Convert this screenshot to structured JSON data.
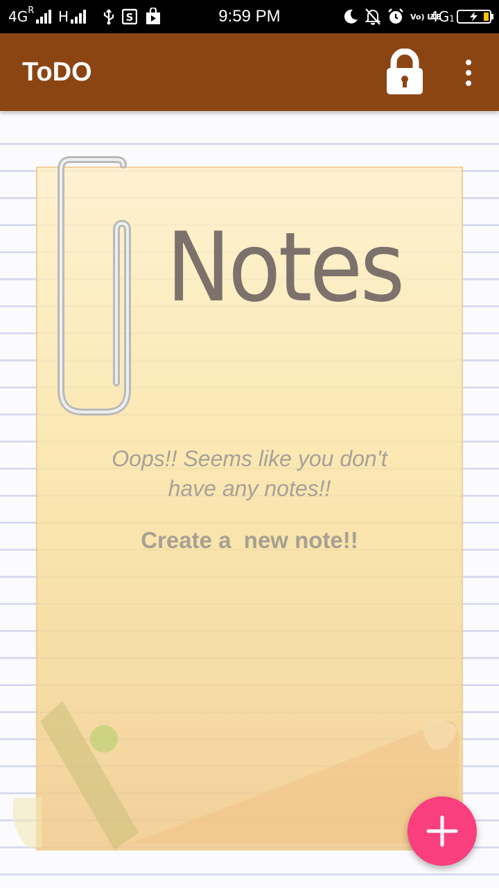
{
  "status_bar": {
    "network_left": "4G",
    "roaming": "R",
    "network_h": "H",
    "time": "9:59 PM",
    "volte": "Vo) LTE",
    "network_right": "4G",
    "sim_slot": "1",
    "icons": [
      "usb-icon",
      "s-app-icon",
      "play-store-icon",
      "moon-icon",
      "notifications-off-icon",
      "alarm-icon",
      "battery-charging-icon"
    ]
  },
  "app_bar": {
    "title": "ToDO",
    "background_color": "#8b4513",
    "lock_icon": "lock-icon",
    "menu_icon": "more-vert-icon"
  },
  "note": {
    "heading": "Notes",
    "empty_message_line1": "Oops!! Seems like you don't",
    "empty_message_line2": "have any notes!!",
    "create_message": "Create a  new note!!"
  },
  "fab": {
    "icon": "plus-icon",
    "color": "#f93f7e"
  }
}
